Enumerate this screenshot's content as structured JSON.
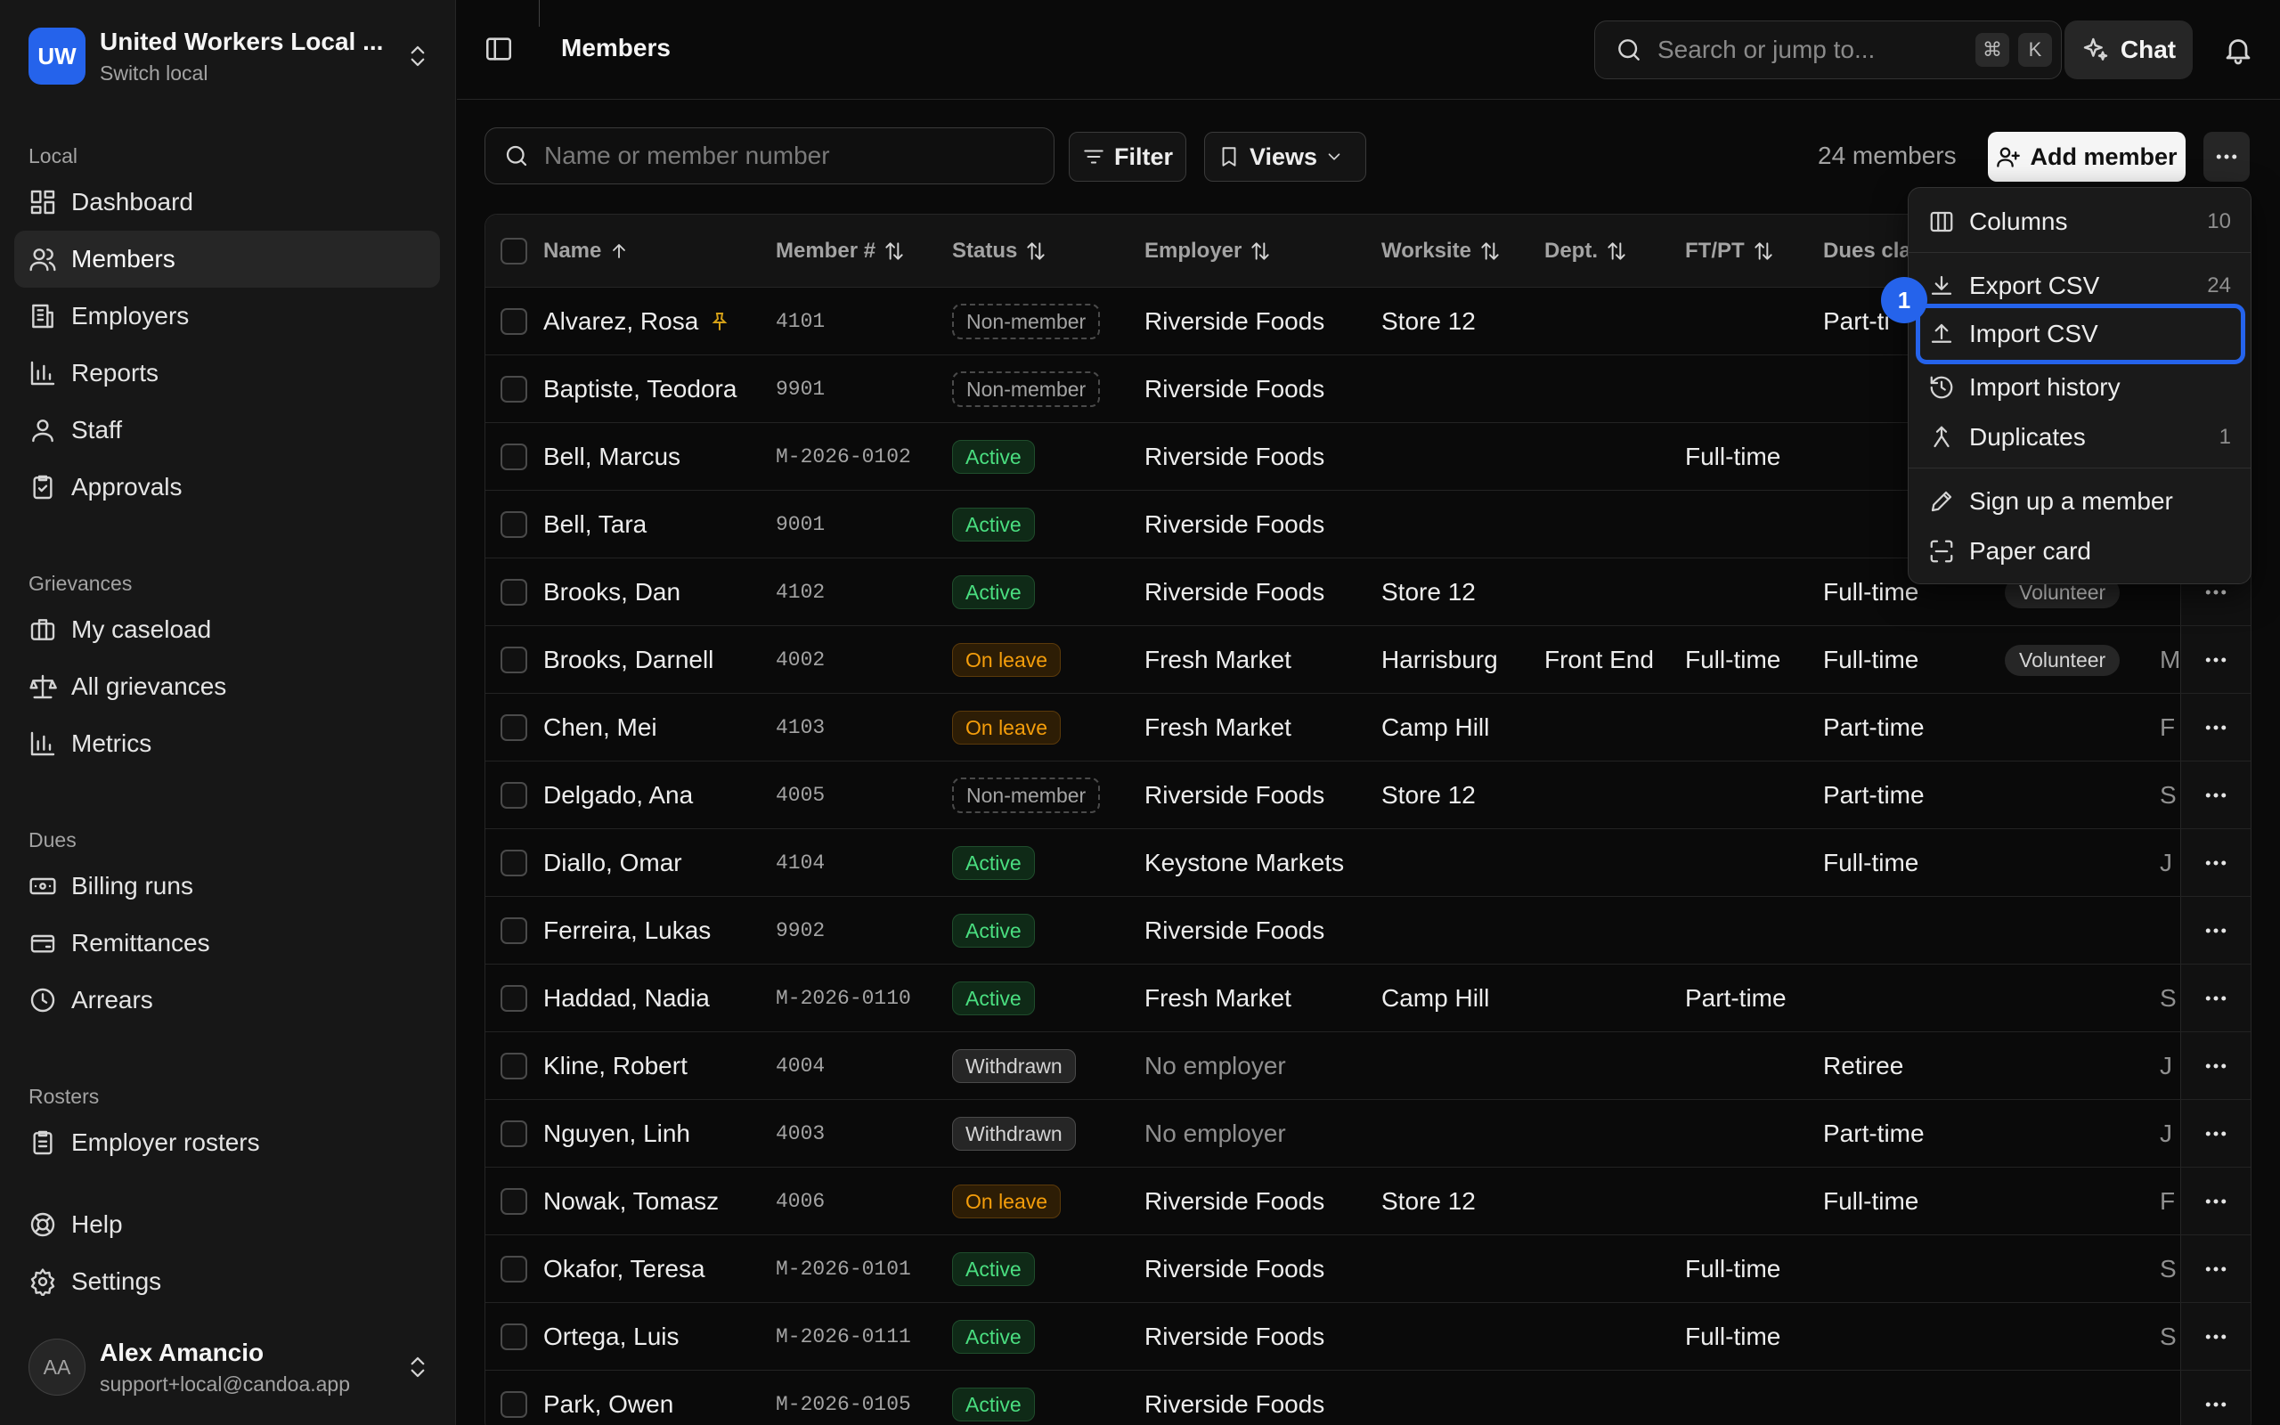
{
  "local": {
    "initials": "UW",
    "name": "United Workers Local ...",
    "subtitle": "Switch local"
  },
  "sidebar": {
    "sections": [
      {
        "label": "Local",
        "items": [
          "Dashboard",
          "Members",
          "Employers",
          "Reports",
          "Staff",
          "Approvals"
        ]
      },
      {
        "label": "Grievances",
        "items": [
          "My caseload",
          "All grievances",
          "Metrics"
        ]
      },
      {
        "label": "Dues",
        "items": [
          "Billing runs",
          "Remittances",
          "Arrears"
        ]
      },
      {
        "label": "Rosters",
        "items": [
          "Employer rosters"
        ]
      }
    ],
    "footer_items": [
      "Help",
      "Settings"
    ],
    "active_item": "Members"
  },
  "user": {
    "initials": "AA",
    "name": "Alex Amancio",
    "email": "support+local@candoa.app"
  },
  "header": {
    "title": "Members",
    "search_placeholder": "Search or jump to...",
    "kbd": [
      "⌘",
      "K"
    ],
    "chat_label": "Chat"
  },
  "toolbar": {
    "search_placeholder": "Name or member number",
    "filter_label": "Filter",
    "views_label": "Views",
    "members_count": "24 members",
    "add_member_label": "Add member"
  },
  "table": {
    "columns": [
      "Name",
      "Member #",
      "Status",
      "Employer",
      "Worksite",
      "Dept.",
      "FT/PT",
      "Dues cla"
    ],
    "rows": [
      {
        "name": "Alvarez, Rosa",
        "pinned": true,
        "member_no": "4101",
        "status": "Non-member",
        "employer": "Riverside Foods",
        "worksite": "Store 12",
        "dept": "",
        "ftpt": "",
        "dues": "Part-ti",
        "tag": "",
        "extra": ""
      },
      {
        "name": "Baptiste, Teodora",
        "member_no": "9901",
        "status": "Non-member",
        "employer": "Riverside Foods",
        "worksite": "",
        "dept": "",
        "ftpt": "",
        "dues": "",
        "tag": "",
        "extra": ""
      },
      {
        "name": "Bell, Marcus",
        "member_no": "M-2026-0102",
        "status": "Active",
        "employer": "Riverside Foods",
        "worksite": "",
        "dept": "",
        "ftpt": "Full-time",
        "dues": "",
        "tag": "",
        "extra": ""
      },
      {
        "name": "Bell, Tara",
        "member_no": "9001",
        "status": "Active",
        "employer": "Riverside Foods",
        "worksite": "",
        "dept": "",
        "ftpt": "",
        "dues": "",
        "tag": "",
        "extra": ""
      },
      {
        "name": "Brooks, Dan",
        "member_no": "4102",
        "status": "Active",
        "employer": "Riverside Foods",
        "worksite": "Store 12",
        "dept": "",
        "ftpt": "",
        "dues": "Full-time",
        "tag": "Volunteer",
        "extra": ""
      },
      {
        "name": "Brooks, Darnell",
        "member_no": "4002",
        "status": "On leave",
        "employer": "Fresh Market",
        "worksite": "Harrisburg",
        "dept": "Front End",
        "ftpt": "Full-time",
        "dues": "Full-time",
        "tag": "Volunteer",
        "extra": "M"
      },
      {
        "name": "Chen, Mei",
        "member_no": "4103",
        "status": "On leave",
        "employer": "Fresh Market",
        "worksite": "Camp Hill",
        "dept": "",
        "ftpt": "",
        "dues": "Part-time",
        "tag": "",
        "extra": "F"
      },
      {
        "name": "Delgado, Ana",
        "member_no": "4005",
        "status": "Non-member",
        "employer": "Riverside Foods",
        "worksite": "Store 12",
        "dept": "",
        "ftpt": "",
        "dues": "Part-time",
        "tag": "",
        "extra": "S"
      },
      {
        "name": "Diallo, Omar",
        "member_no": "4104",
        "status": "Active",
        "employer": "Keystone Markets",
        "worksite": "",
        "dept": "",
        "ftpt": "",
        "dues": "Full-time",
        "tag": "",
        "extra": "J"
      },
      {
        "name": "Ferreira, Lukas",
        "member_no": "9902",
        "status": "Active",
        "employer": "Riverside Foods",
        "worksite": "",
        "dept": "",
        "ftpt": "",
        "dues": "",
        "tag": "",
        "extra": ""
      },
      {
        "name": "Haddad, Nadia",
        "member_no": "M-2026-0110",
        "status": "Active",
        "employer": "Fresh Market",
        "worksite": "Camp Hill",
        "dept": "",
        "ftpt": "Part-time",
        "dues": "",
        "tag": "",
        "extra": "S"
      },
      {
        "name": "Kline, Robert",
        "member_no": "4004",
        "status": "Withdrawn",
        "employer": "No employer",
        "employer_muted": true,
        "worksite": "",
        "dept": "",
        "ftpt": "",
        "dues": "Retiree",
        "tag": "",
        "extra": "J"
      },
      {
        "name": "Nguyen, Linh",
        "member_no": "4003",
        "status": "Withdrawn",
        "employer": "No employer",
        "employer_muted": true,
        "worksite": "",
        "dept": "",
        "ftpt": "",
        "dues": "Part-time",
        "tag": "",
        "extra": "J"
      },
      {
        "name": "Nowak, Tomasz",
        "member_no": "4006",
        "status": "On leave",
        "employer": "Riverside Foods",
        "worksite": "Store 12",
        "dept": "",
        "ftpt": "",
        "dues": "Full-time",
        "tag": "",
        "extra": "F"
      },
      {
        "name": "Okafor, Teresa",
        "member_no": "M-2026-0101",
        "status": "Active",
        "employer": "Riverside Foods",
        "worksite": "",
        "dept": "",
        "ftpt": "Full-time",
        "dues": "",
        "tag": "",
        "extra": "S"
      },
      {
        "name": "Ortega, Luis",
        "member_no": "M-2026-0111",
        "status": "Active",
        "employer": "Riverside Foods",
        "worksite": "",
        "dept": "",
        "ftpt": "Full-time",
        "dues": "",
        "tag": "",
        "extra": "S"
      },
      {
        "name": "Park, Owen",
        "member_no": "M-2026-0105",
        "status": "Active",
        "employer": "Riverside Foods",
        "worksite": "",
        "dept": "",
        "ftpt": "",
        "dues": "",
        "tag": "",
        "extra": ""
      }
    ]
  },
  "menu": {
    "items": [
      {
        "label": "Columns",
        "count": "10",
        "icon": "columns-icon"
      },
      {
        "label": "Export CSV",
        "count": "24",
        "icon": "download-icon"
      },
      {
        "label": "Import CSV",
        "count": "",
        "icon": "upload-icon",
        "focused": true
      },
      {
        "label": "Import history",
        "count": "",
        "icon": "history-icon"
      },
      {
        "label": "Duplicates",
        "count": "1",
        "icon": "merge-icon"
      },
      {
        "label": "Sign up a member",
        "count": "",
        "icon": "pen-icon"
      },
      {
        "label": "Paper card",
        "count": "",
        "icon": "scan-icon"
      }
    ],
    "step_marker": "1"
  },
  "colors": {
    "accent": "#2563eb",
    "active_green": "#4ade80",
    "leave_amber": "#f59e0b"
  }
}
